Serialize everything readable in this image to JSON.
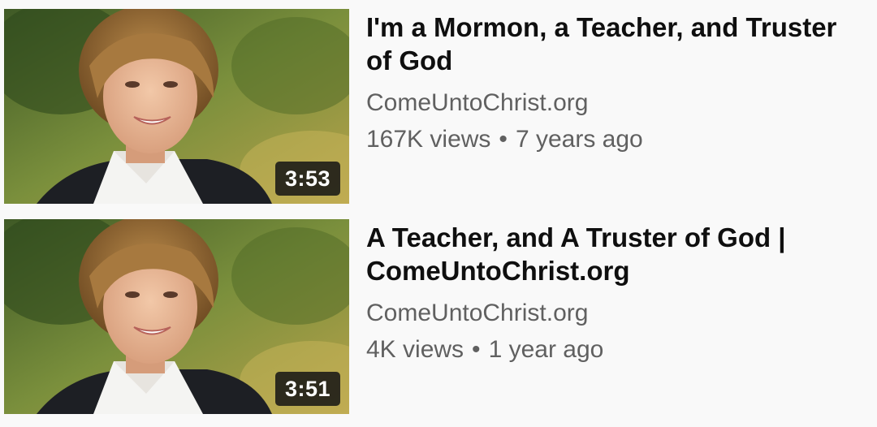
{
  "videos": [
    {
      "title": "I'm a Mormon, a Teacher, and Truster of God",
      "channel": "ComeUntoChrist.org",
      "views": "167K views",
      "separator": "•",
      "age": "7 years ago",
      "duration": "3:53"
    },
    {
      "title": "A Teacher, and A Truster of God | ComeUntoChrist.org",
      "channel": "ComeUntoChrist.org",
      "views": "4K views",
      "separator": "•",
      "age": "1 year ago",
      "duration": "3:51"
    }
  ]
}
